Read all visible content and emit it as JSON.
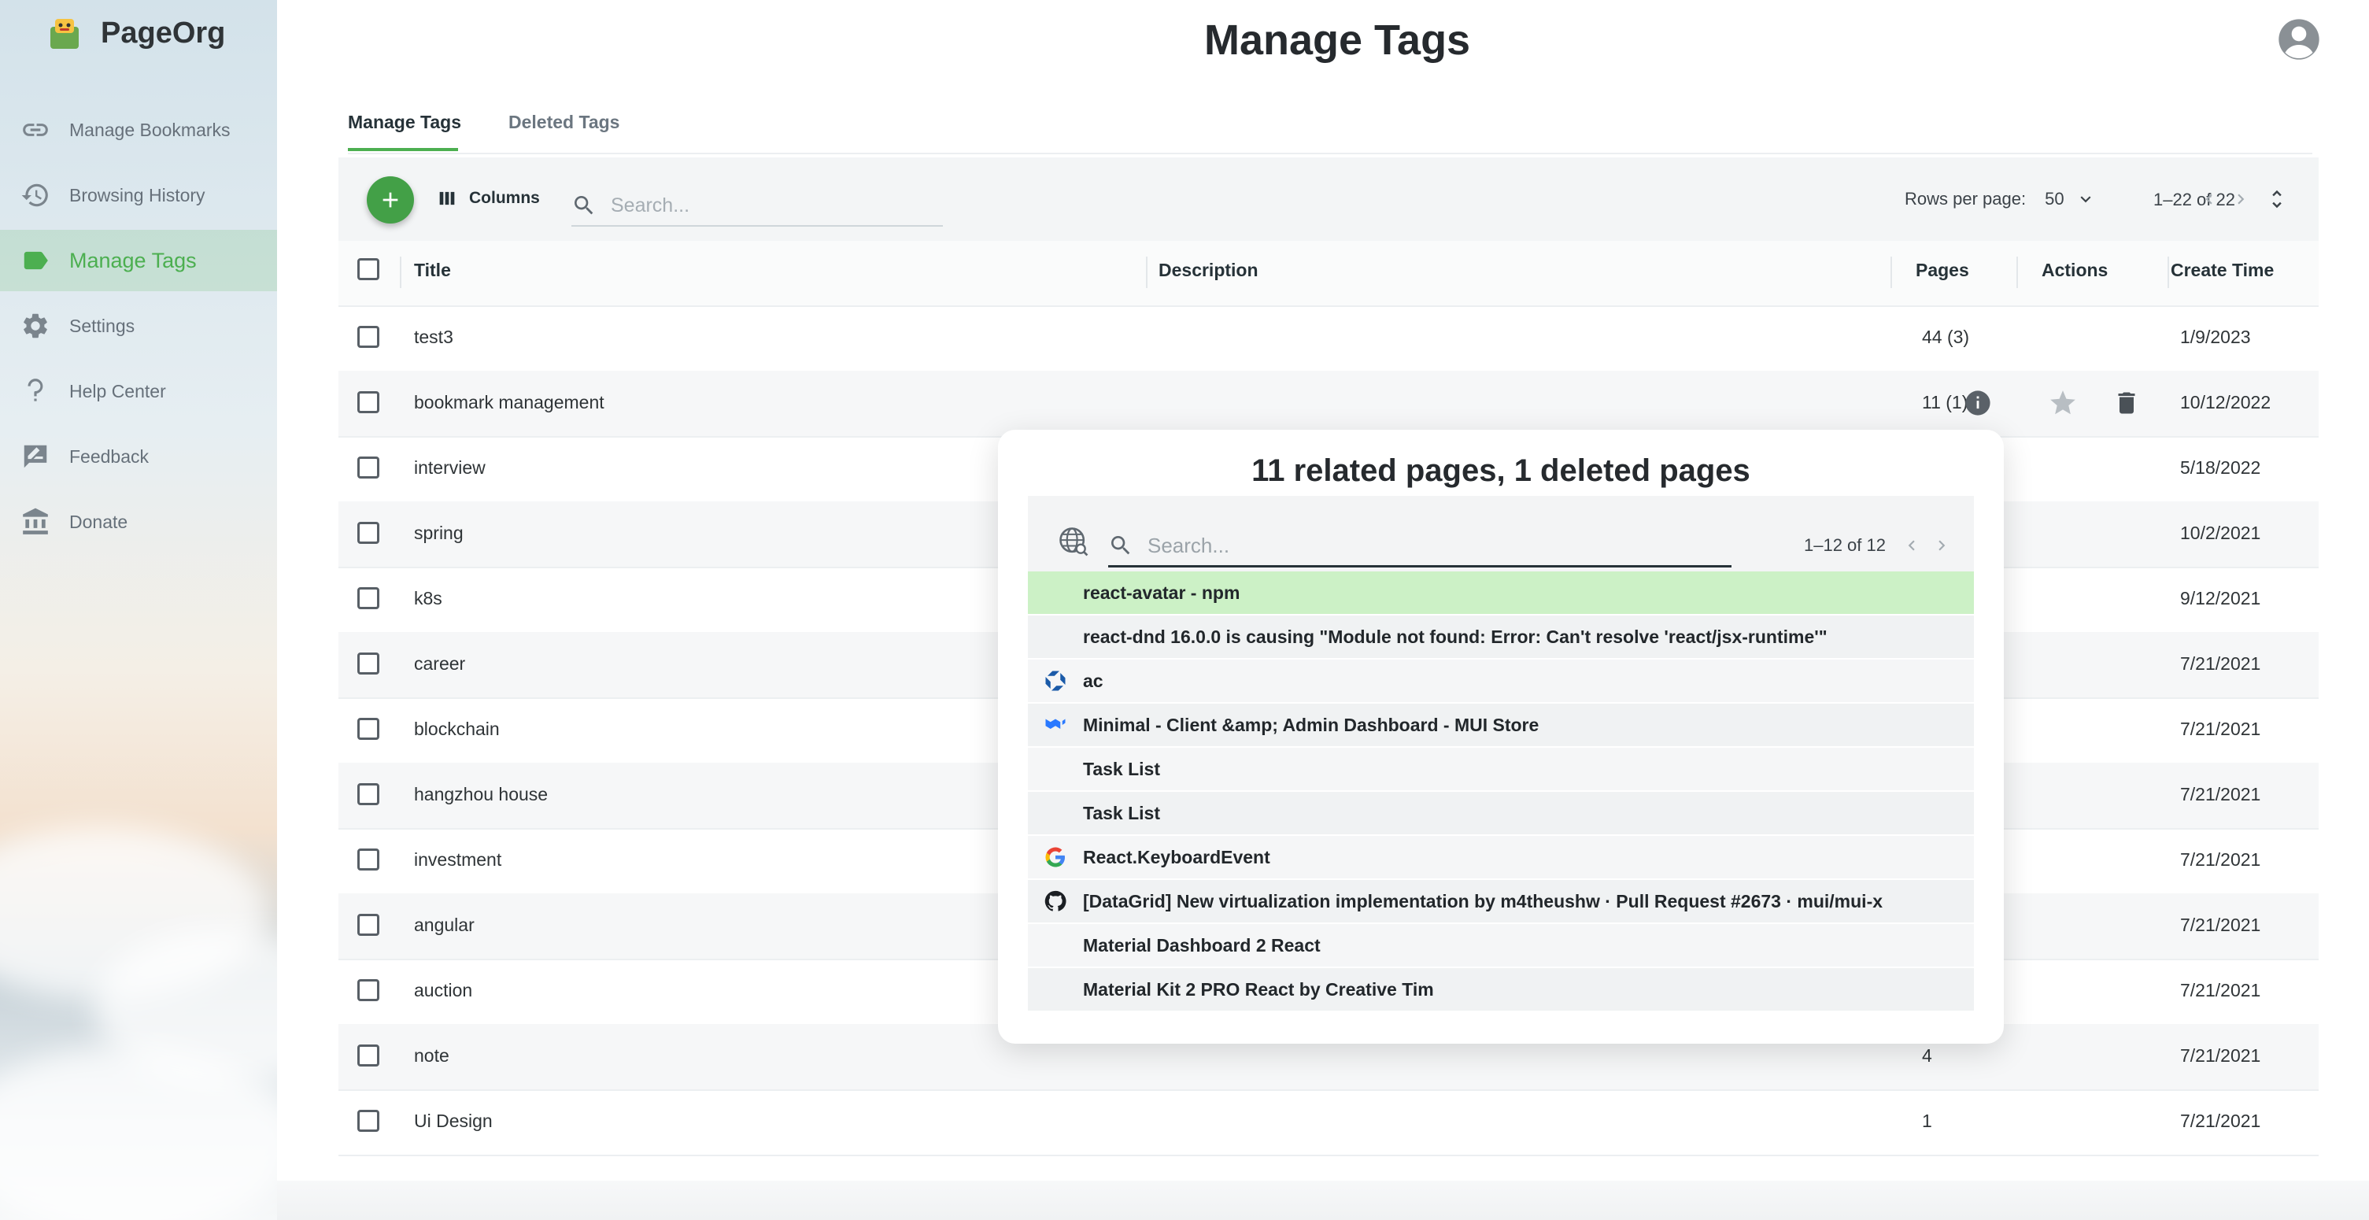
{
  "app": {
    "name": "PageOrg"
  },
  "sidebar": {
    "items": [
      {
        "label": "Manage Bookmarks",
        "icon": "link-icon"
      },
      {
        "label": "Browsing History",
        "icon": "history-icon"
      },
      {
        "label": "Manage Tags",
        "icon": "tag-icon",
        "active": true
      },
      {
        "label": "Settings",
        "icon": "gear-icon"
      },
      {
        "label": "Help Center",
        "icon": "question-icon"
      },
      {
        "label": "Feedback",
        "icon": "feedback-icon"
      },
      {
        "label": "Donate",
        "icon": "bank-icon"
      }
    ]
  },
  "header": {
    "title": "Manage Tags"
  },
  "tabs": [
    {
      "label": "Manage Tags",
      "active": true
    },
    {
      "label": "Deleted Tags",
      "active": false
    }
  ],
  "toolbar": {
    "columns_label": "Columns",
    "search_placeholder": "Search...",
    "rows_per_page_label": "Rows per page:",
    "rows_per_page_value": "50",
    "page_range": "1–22 of 22"
  },
  "table": {
    "columns": [
      "Title",
      "Description",
      "Pages",
      "Actions",
      "Create Time"
    ],
    "rows": [
      {
        "title": "test3",
        "description": "",
        "pages": "44 (3)",
        "created": "1/9/2023"
      },
      {
        "title": "bookmark management",
        "description": "",
        "pages": "11 (1)",
        "created": "10/12/2022"
      },
      {
        "title": "interview",
        "description": "",
        "pages": "",
        "created": "5/18/2022"
      },
      {
        "title": "spring",
        "description": "",
        "pages": "",
        "created": "10/2/2021"
      },
      {
        "title": "k8s",
        "description": "",
        "pages": "",
        "created": "9/12/2021"
      },
      {
        "title": "career",
        "description": "",
        "pages": "",
        "created": "7/21/2021"
      },
      {
        "title": "blockchain",
        "description": "",
        "pages": "",
        "created": "7/21/2021"
      },
      {
        "title": "hangzhou house",
        "description": "",
        "pages": "",
        "created": "7/21/2021"
      },
      {
        "title": "investment",
        "description": "",
        "pages": "",
        "created": "7/21/2021"
      },
      {
        "title": "angular",
        "description": "",
        "pages": "",
        "created": "7/21/2021"
      },
      {
        "title": "auction",
        "description": "",
        "pages": "",
        "created": "7/21/2021"
      },
      {
        "title": "note",
        "description": "",
        "pages": "4",
        "created": "7/21/2021"
      },
      {
        "title": "Ui Design",
        "description": "",
        "pages": "1",
        "created": "7/21/2021"
      }
    ]
  },
  "popup": {
    "title": "11 related pages, 1 deleted pages",
    "search_placeholder": "Search...",
    "page_range": "1–12 of 12",
    "items": [
      {
        "label": "react-avatar - npm",
        "favicon": "",
        "highlighted": true
      },
      {
        "label": "react-dnd 16.0.0 is causing \"Module not found: Error: Can't resolve 'react/jsx-runtime'\"",
        "favicon": ""
      },
      {
        "label": "ac",
        "favicon": "bank-chase-icon"
      },
      {
        "label": "Minimal - Client &amp; Admin Dashboard - MUI Store",
        "favicon": "mui-icon"
      },
      {
        "label": "Task List",
        "favicon": ""
      },
      {
        "label": "Task List",
        "favicon": ""
      },
      {
        "label": "React.KeyboardEvent",
        "favicon": "google-icon"
      },
      {
        "label": "[DataGrid] New virtualization implementation by m4theushw · Pull Request #2673 · mui/mui-x",
        "favicon": "github-icon"
      },
      {
        "label": "Material Dashboard 2 React",
        "favicon": ""
      },
      {
        "label": "Material Kit 2 PRO React by Creative Tim",
        "favicon": ""
      }
    ]
  },
  "colors": {
    "accent": "#4caf50",
    "fab": "#43a047",
    "highlight": "#ccf1c6"
  }
}
